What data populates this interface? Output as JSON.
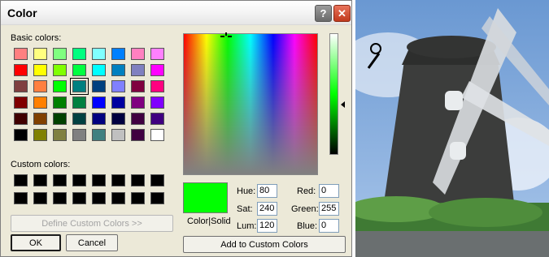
{
  "dialog": {
    "title": "Color",
    "help_label": "?",
    "close_label": "✕",
    "basic_colors_label": "Basic colors:",
    "custom_colors_label": "Custom colors:",
    "define_custom_label": "Define Custom Colors >>",
    "ok_label": "OK",
    "cancel_label": "Cancel",
    "color_solid_label": "Color|Solid",
    "add_custom_label": "Add to Custom Colors",
    "selected_swatch_index": 19,
    "preview_color": "#00ff00",
    "basic_colors": [
      "#ff8080",
      "#ffff80",
      "#80ff80",
      "#00ff80",
      "#80ffff",
      "#0080ff",
      "#ff80c0",
      "#ff80ff",
      "#ff0000",
      "#ffff00",
      "#80ff00",
      "#00ff40",
      "#00ffff",
      "#0080c0",
      "#8080c0",
      "#ff00ff",
      "#804040",
      "#ff8040",
      "#00ff00",
      "#008080",
      "#004080",
      "#8080ff",
      "#800040",
      "#ff0080",
      "#800000",
      "#ff8000",
      "#008000",
      "#008040",
      "#0000ff",
      "#0000a0",
      "#800080",
      "#8000ff",
      "#400000",
      "#804000",
      "#004000",
      "#004040",
      "#000080",
      "#000040",
      "#400040",
      "#400080",
      "#000000",
      "#808000",
      "#808040",
      "#808080",
      "#408080",
      "#c0c0c0",
      "#400040",
      "#ffffff"
    ],
    "fields": {
      "hue": {
        "label": "Hue:",
        "value": "80"
      },
      "sat": {
        "label": "Sat:",
        "value": "240"
      },
      "lum": {
        "label": "Lum:",
        "value": "120"
      },
      "red": {
        "label": "Red:",
        "value": "0"
      },
      "green": {
        "label": "Green:",
        "value": "255"
      },
      "blue": {
        "label": "Blue:",
        "value": "0"
      }
    }
  }
}
